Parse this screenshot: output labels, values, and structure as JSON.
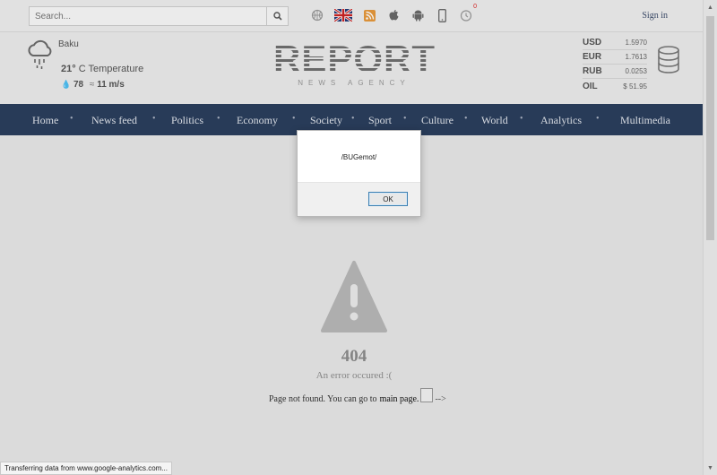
{
  "topbar": {
    "search_placeholder": "Search...",
    "icons": [
      "basketball-icon",
      "uk-flag-icon",
      "rss-icon",
      "apple-icon",
      "android-icon",
      "mobile-icon",
      "clock-icon"
    ],
    "notification_count": "0",
    "signin_label": "Sign in"
  },
  "weather": {
    "city": "Baku",
    "temp_value": "21°",
    "temp_label": "C Temperature",
    "humidity": "78",
    "wind": "11 m/s"
  },
  "logo": {
    "title": "REPORT",
    "subtitle": "NEWS AGENCY"
  },
  "rates": [
    {
      "code": "USD",
      "value": "1.5970"
    },
    {
      "code": "EUR",
      "value": "1.7613"
    },
    {
      "code": "RUB",
      "value": "0.0253"
    },
    {
      "code": "OIL",
      "value": "$ 51.95"
    }
  ],
  "nav": [
    "Home",
    "News feed",
    "Politics",
    "Economy",
    "Society",
    "Sport",
    "Culture",
    "World",
    "Analytics",
    "Multimedia"
  ],
  "error": {
    "code": "404",
    "message": "An error occured :(",
    "notfound_text": "Page not found. You can go to",
    "link_text": "main page.",
    "tail_text": "-->"
  },
  "dialog": {
    "message": "/BUGemot/",
    "ok_label": "OK"
  },
  "status_text": "Transferring data from www.google-analytics.com...",
  "colors": {
    "nav_bg": "#2b3f5e",
    "accent": "#3a4a6a"
  }
}
